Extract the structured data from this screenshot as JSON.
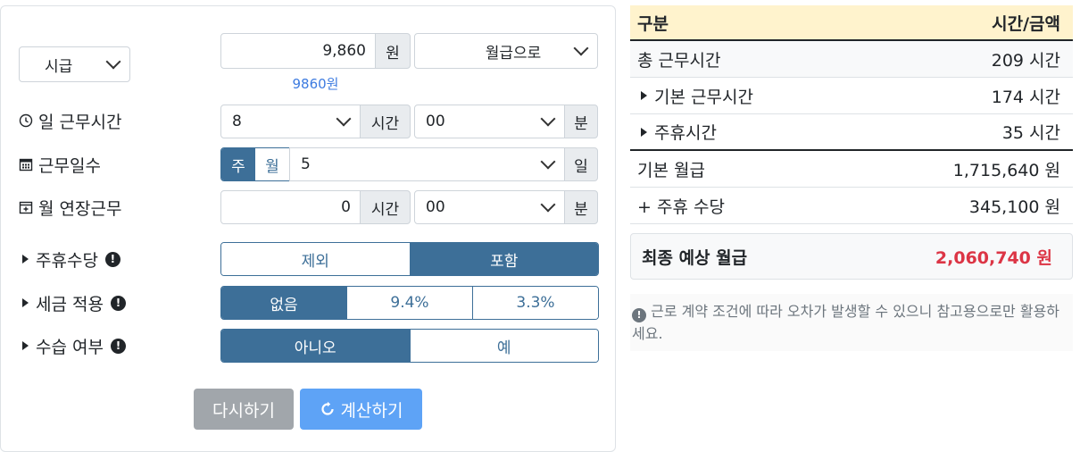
{
  "form": {
    "pay_type": "시급",
    "wage_value": "9,860",
    "wage_unit": "원",
    "convert_mode": "월급으로",
    "wage_hint": "9860원",
    "daily_hours_label": "일 근무시간",
    "daily_hours": "8",
    "hours_unit": "시간",
    "daily_minutes": "00",
    "minutes_unit": "분",
    "workdays_label": "근무일수",
    "workdays_tab_week": "주",
    "workdays_tab_month": "월",
    "workdays_value": "5",
    "days_unit": "일",
    "overtime_label": "월 연장근무",
    "overtime_hours": "0",
    "overtime_minutes": "00",
    "holiday_label": "주휴수당",
    "holiday_options": [
      "제외",
      "포함"
    ],
    "holiday_selected": 1,
    "tax_label": "세금 적용",
    "tax_options": [
      "없음",
      "9.4%",
      "3.3%"
    ],
    "tax_selected": 0,
    "probation_label": "수습 여부",
    "probation_options": [
      "아니오",
      "예"
    ],
    "probation_selected": 0,
    "reset_label": "다시하기",
    "calc_label": "계산하기"
  },
  "result": {
    "header_col1": "구분",
    "header_col2": "시간/금액",
    "rows": [
      {
        "label": "총 근무시간",
        "value": "209 시간"
      },
      {
        "label": "기본 근무시간",
        "value": "174 시간"
      },
      {
        "label": "주휴시간",
        "value": "35 시간"
      },
      {
        "label": "기본 월급",
        "value": "1,715,640 원"
      },
      {
        "label": "+ 주휴 수당",
        "value": "345,100 원"
      }
    ],
    "final_label": "최종 예상 월급",
    "final_value": "2,060,740 원",
    "notice": "근로 계약 조건에 따라 오차가 발생할 수 있으니 참고용으로만 활용하세요."
  },
  "colors": {
    "primary": "#3d6f98",
    "header_bg": "#fff3cd",
    "final_red": "#dc3545",
    "reset_gray": "#a1a6ab",
    "calc_blue": "#5ea3f6",
    "hint_blue": "#3d7be0"
  }
}
